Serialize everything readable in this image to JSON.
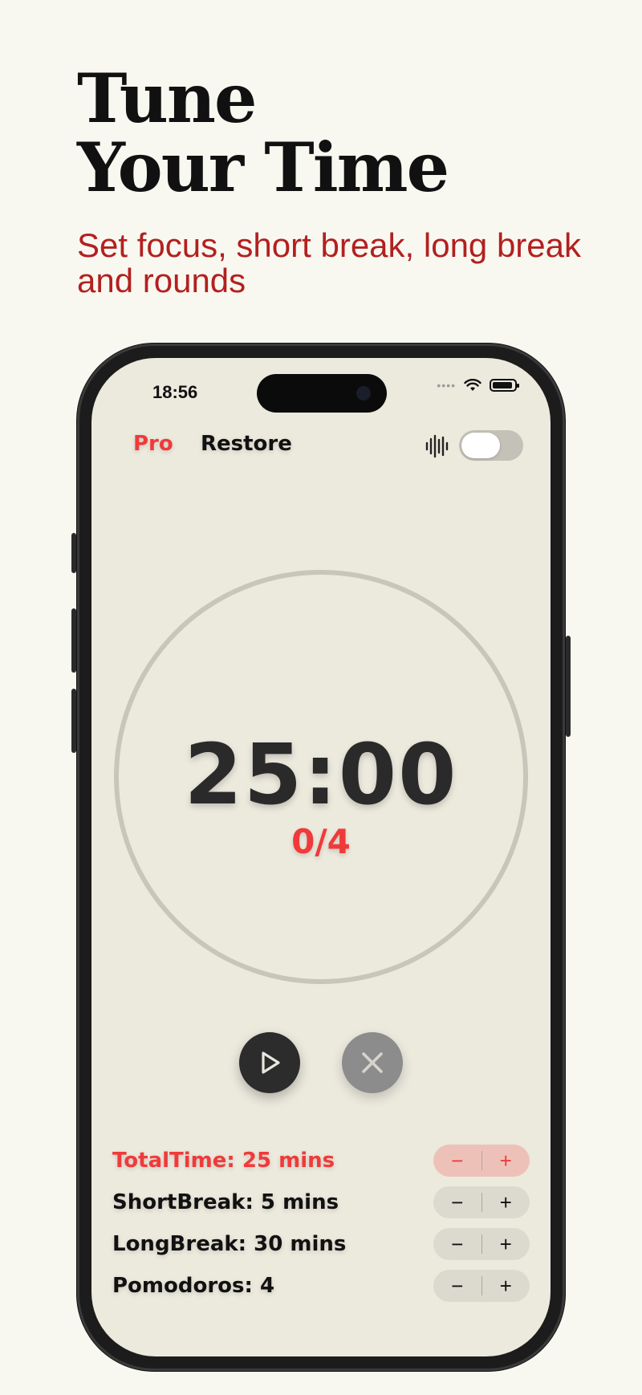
{
  "headline": {
    "line1": "Tune",
    "line2": "Your Time",
    "subtitle": "Set focus, short break, long break and rounds"
  },
  "status_bar": {
    "time": "18:56",
    "icons": [
      "wifi-icon",
      "battery-icon"
    ]
  },
  "top_bar": {
    "pro_label": "Pro",
    "restore_label": "Restore",
    "sound_icon": "waveform-icon",
    "sound_toggle_on": false
  },
  "timer": {
    "display": "25:00",
    "rounds": "0/4"
  },
  "controls": {
    "play_icon": "play-icon",
    "stop_icon": "close-icon"
  },
  "settings": [
    {
      "label": "TotalTime:",
      "value": "25 mins",
      "active": true
    },
    {
      "label": "ShortBreak:",
      "value": "5 mins",
      "active": false
    },
    {
      "label": "LongBreak:",
      "value": "30 mins",
      "active": false
    },
    {
      "label": "Pomodoros:",
      "value": "4",
      "active": false
    }
  ],
  "stepper": {
    "minus": "−",
    "plus": "+"
  },
  "colors": {
    "accent": "#f03a3a",
    "subtitle": "#b3201f",
    "screen_bg": "#ece9dd",
    "page_bg": "#f8f8f1"
  }
}
